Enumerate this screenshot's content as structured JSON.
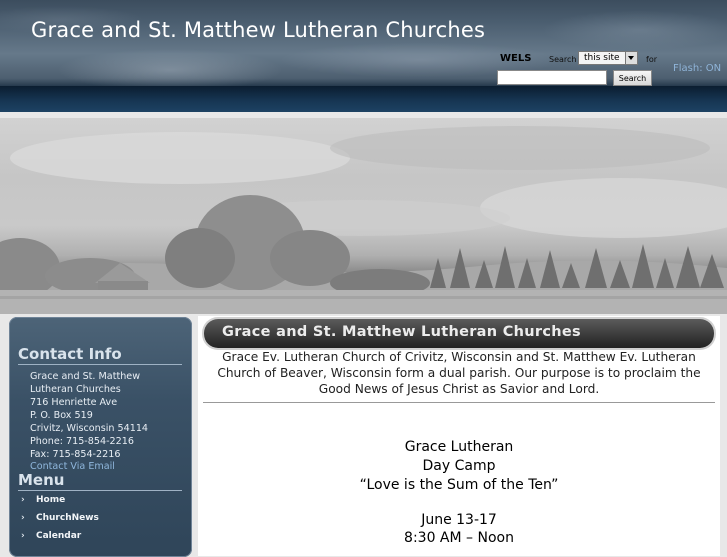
{
  "header": {
    "site_title": "Grace and St. Matthew Lutheran Churches",
    "wels": "WELS",
    "search_label": "Search",
    "search_scope": "this site",
    "for_label": "for",
    "search_value": "",
    "search_button": "Search",
    "flash": "Flash: ON"
  },
  "sidebar": {
    "contact_heading": "Contact Info",
    "contact_lines": [
      "Grace and St. Matthew",
      "Lutheran Churches",
      "716 Henriette Ave",
      "P. O. Box 519",
      "Crivitz, Wisconsin  54114",
      "Phone: 715-854-2216",
      "Fax: 715-854-2216"
    ],
    "contact_email": "Contact Via Email",
    "menu_heading": "Menu",
    "menu_items": [
      "Home",
      "ChurchNews",
      "Calendar"
    ]
  },
  "main": {
    "title": "Grace and St. Matthew Lutheran Churches",
    "intro": "Grace Ev. Lutheran Church of Crivitz, Wisconsin and St. Matthew Ev. Lutheran Church of Beaver, Wisconsin form a dual parish.  Our purpose is to proclaim the Good News of Jesus Christ as Savior and Lord.",
    "announcement": [
      "Grace Lutheran",
      "Day Camp",
      "“Love is the Sum of the Ten”",
      "June 13-17",
      "8:30 AM – Noon"
    ]
  },
  "colors": {
    "header_band": "#163552",
    "sidebar_bg": "#3a5166",
    "title_bar": "#3b3b3b",
    "link": "#8fb6dc"
  }
}
